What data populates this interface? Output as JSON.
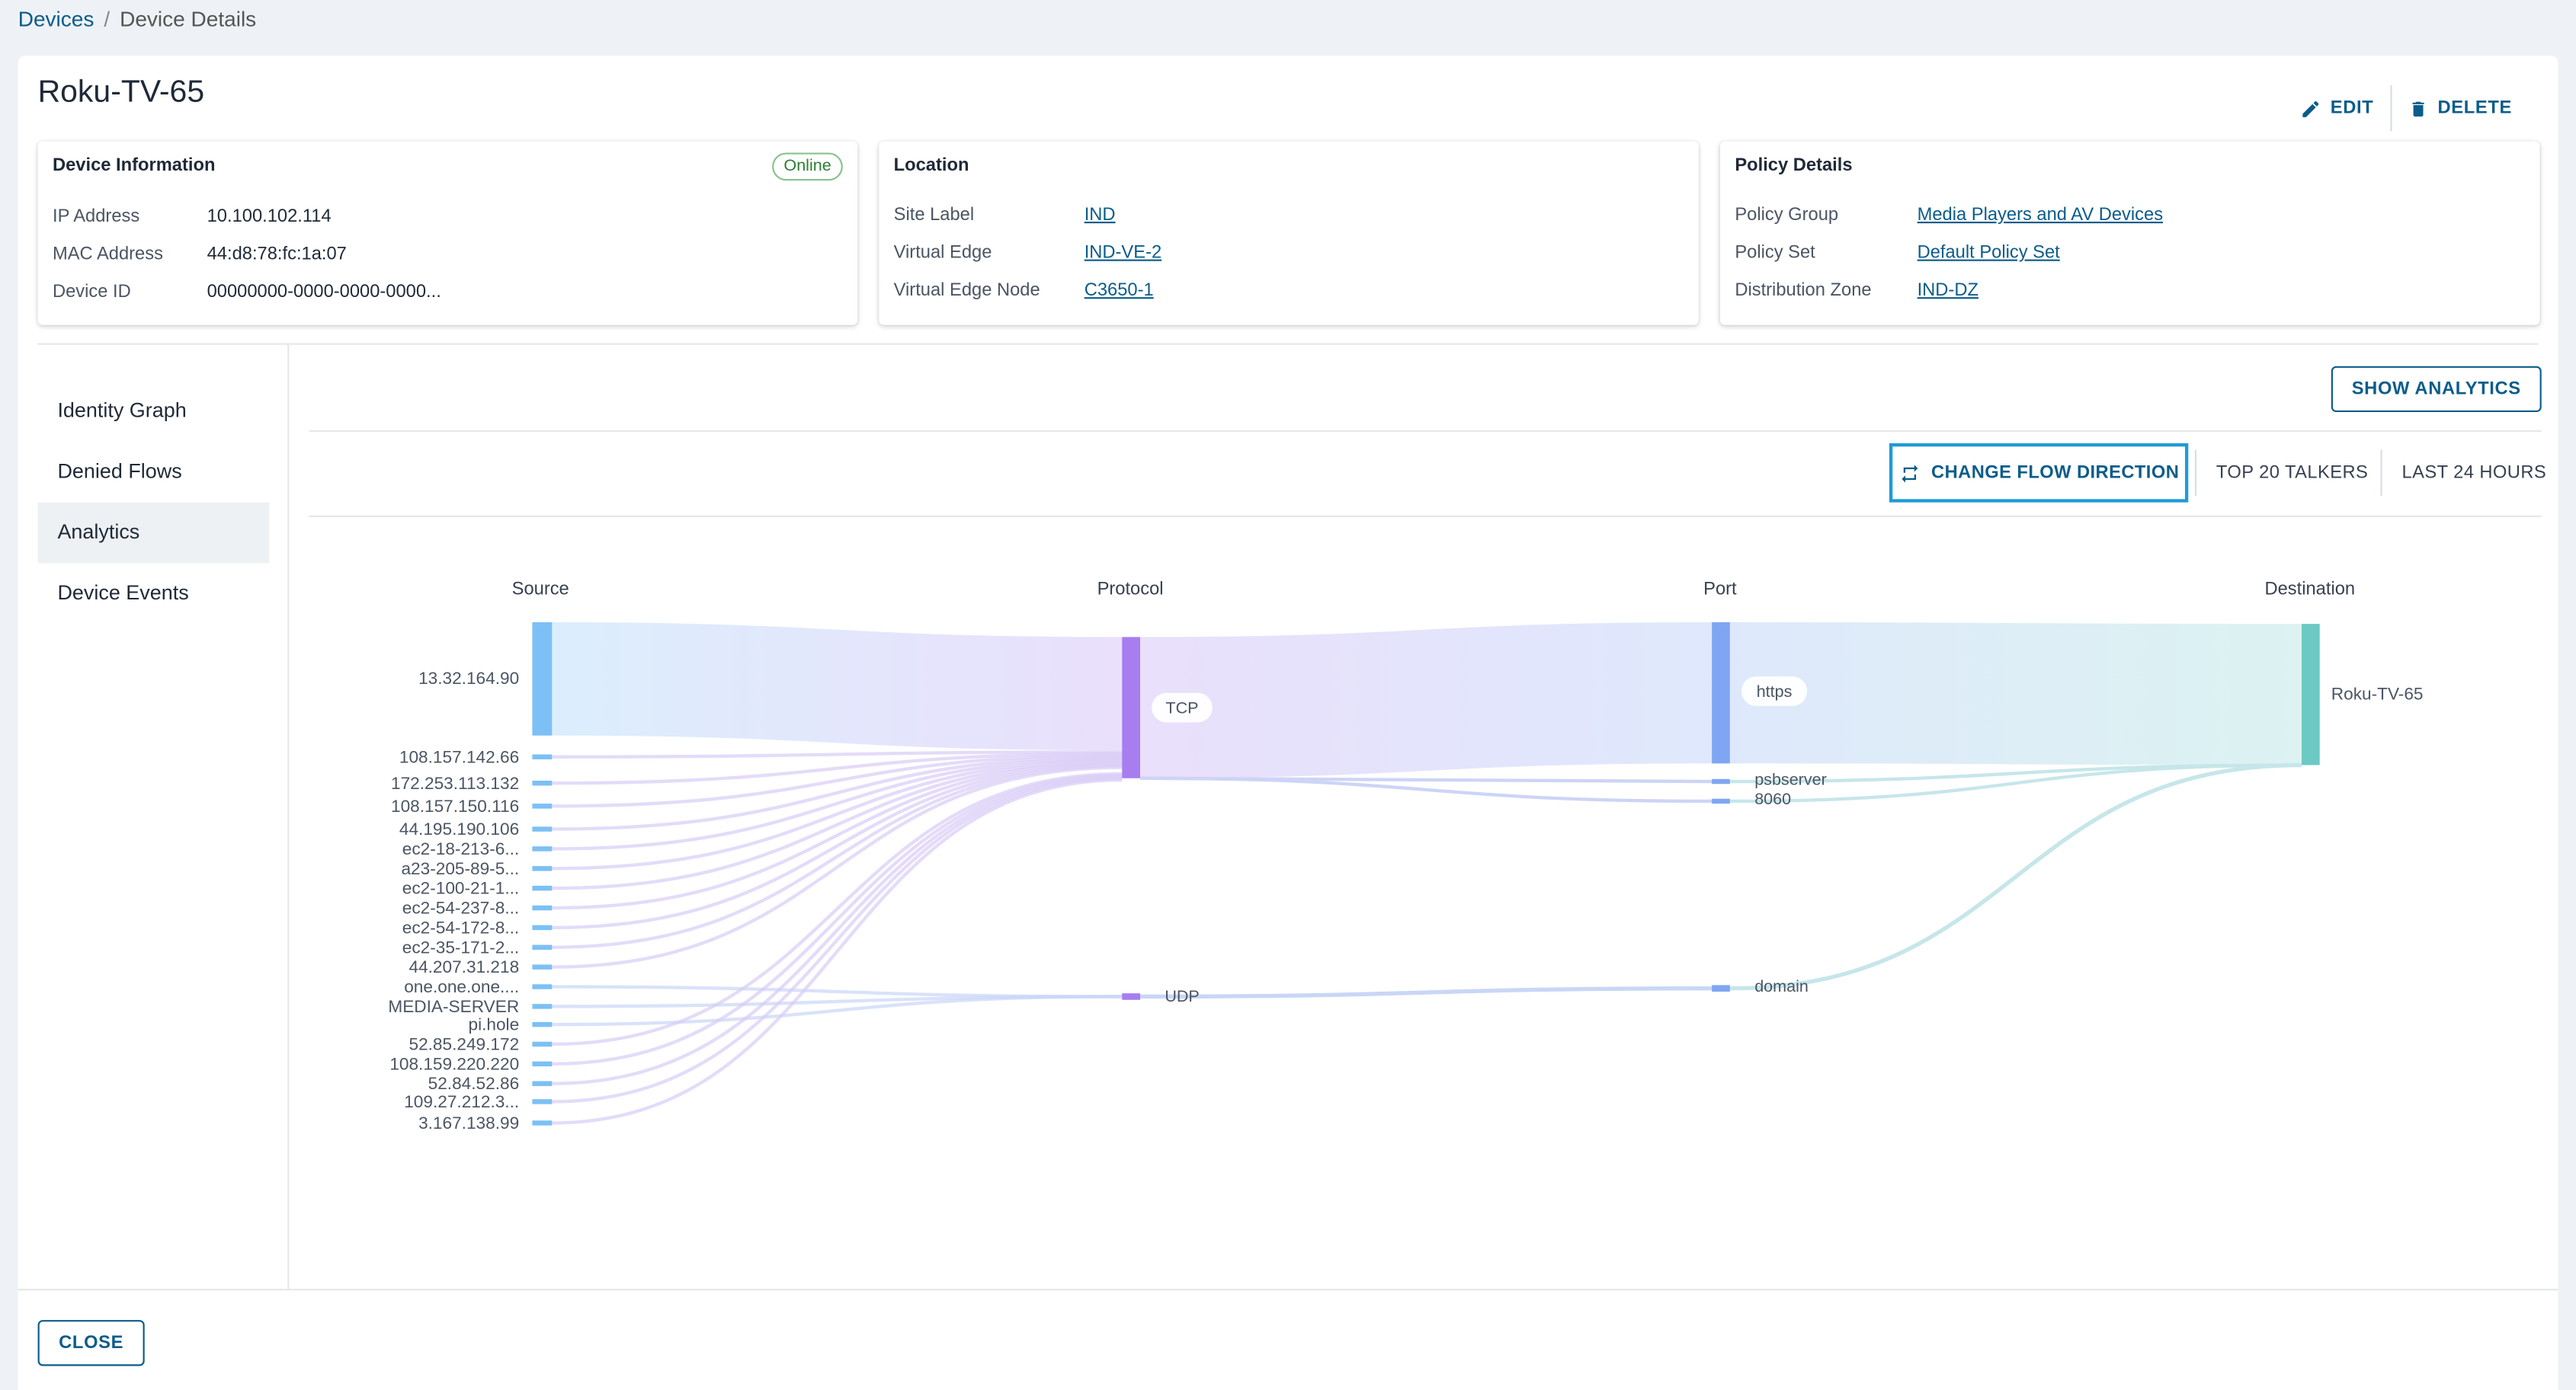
{
  "breadcrumb": {
    "root": "Devices",
    "separator": "/",
    "current": "Device Details"
  },
  "title": "Roku-TV-65",
  "actions": {
    "edit": "EDIT",
    "delete": "DELETE"
  },
  "device_info": {
    "title": "Device Information",
    "status": "Online",
    "rows": [
      {
        "label": "IP Address",
        "value": "10.100.102.114"
      },
      {
        "label": "MAC Address",
        "value": "44:d8:78:fc:1a:07"
      },
      {
        "label": "Device ID",
        "value": "00000000-0000-0000-0000..."
      }
    ]
  },
  "location": {
    "title": "Location",
    "rows": [
      {
        "label": "Site Label",
        "value": "IND"
      },
      {
        "label": "Virtual Edge",
        "value": "IND-VE-2"
      },
      {
        "label": "Virtual Edge Node",
        "value": "C3650-1"
      }
    ]
  },
  "policy": {
    "title": "Policy Details",
    "rows": [
      {
        "label": "Policy Group",
        "value": "Media Players and AV Devices"
      },
      {
        "label": "Policy Set",
        "value": "Default Policy Set"
      },
      {
        "label": "Distribution Zone",
        "value": "IND-DZ"
      }
    ]
  },
  "nav": {
    "items": [
      "Identity Graph",
      "Denied Flows",
      "Analytics",
      "Device Events"
    ],
    "active": "Analytics"
  },
  "toolbar": {
    "show_analytics": "SHOW ANALYTICS",
    "change_flow": "CHANGE FLOW DIRECTION",
    "top_talkers": "TOP 20 TALKERS",
    "time_range": "LAST 24 HOURS"
  },
  "sankey": {
    "columns": [
      "Source",
      "Protocol",
      "Port",
      "Destination"
    ],
    "sources": [
      "13.32.164.90",
      "108.157.142.66",
      "172.253.113.132",
      "108.157.150.116",
      "44.195.190.106",
      "ec2-18-213-6...",
      "a23-205-89-5...",
      "ec2-100-21-1...",
      "ec2-54-237-8...",
      "ec2-54-172-8...",
      "ec2-35-171-2...",
      "44.207.31.218",
      "one.one.one....",
      "MEDIA-SERVER",
      "pi.hole",
      "52.85.249.172",
      "108.159.220.220",
      "52.84.52.86",
      "109.27.212.3...",
      "3.167.138.99"
    ],
    "protocols": [
      "TCP",
      "UDP"
    ],
    "ports": [
      "https",
      "psbserver",
      "8060",
      "domain"
    ],
    "destinations": [
      "Roku-TV-65"
    ],
    "colors": {
      "source": "#7cc0f5",
      "protocol": "#a77df0",
      "port": "#7fa6f2",
      "destination": "#6cc9c4"
    }
  },
  "footer": {
    "close": "CLOSE"
  }
}
